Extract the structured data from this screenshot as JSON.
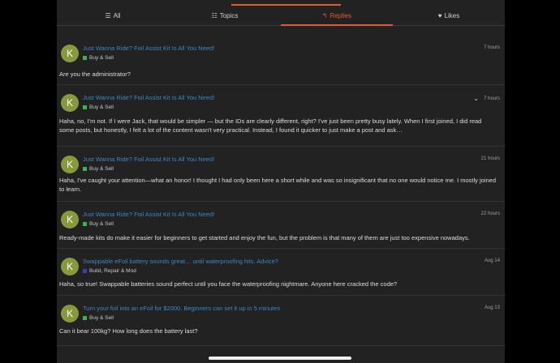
{
  "colors": {
    "accent": "#e45735",
    "link": "#3e86c4",
    "avatar": "#869a3c"
  },
  "tabs": [
    {
      "label": "All",
      "icon": "list-icon",
      "active": false
    },
    {
      "label": "Topics",
      "icon": "list-bullet-icon",
      "active": false
    },
    {
      "label": "Replies",
      "icon": "reply-icon",
      "active": true
    },
    {
      "label": "Likes",
      "icon": "heart-icon",
      "active": false
    }
  ],
  "posts": [
    {
      "avatar": "K",
      "title": "Just Wanna Ride? Foil Assist Kit Is All You Need!",
      "category": "Buy & Sell",
      "category_color": "#3ab54a",
      "time": "7 hours",
      "body": "Are you the administrator?"
    },
    {
      "avatar": "K",
      "title": "Just Wanna Ride? Foil Assist Kit Is All You Need!",
      "category": "Buy & Sell",
      "category_color": "#3ab54a",
      "time": "7 hours",
      "body": "Haha, no, I'm not. If I were Jack, that would be simpler — but the IDs are clearly different, right? I've just been pretty busy lately. When I first joined, I did read some posts, but honestly, I felt a lot of the content wasn't very practical. Instead, I found it quicker to just make a post and ask…"
    },
    {
      "avatar": "K",
      "title": "Just Wanna Ride? Foil Assist Kit Is All You Need!",
      "category": "Buy & Sell",
      "category_color": "#3ab54a",
      "time": "21 hours",
      "body": "Haha, I've caught your attention—what an honor! I thought I had only been here a short while and was so insignificant that no one would notice me. I mostly joined to learn."
    },
    {
      "avatar": "K",
      "title": "Just Wanna Ride? Foil Assist Kit Is All You Need!",
      "category": "Buy & Sell",
      "category_color": "#3ab54a",
      "time": "22 hours",
      "body": "Ready-made kits do make it easier for beginners to get started and enjoy the fun, but the problem is that many of them are just too expensive nowadays."
    },
    {
      "avatar": "K",
      "title": "Swappable eFoil battery sounds great… until waterproofing hits. Advice?",
      "category": "Build, Repair & Mod",
      "category_color": "#3b3fb5",
      "time": "Aug 14",
      "body": "Haha, so true! Swappable batteries sound perfect until you face the waterproofing nightmare. Anyone here cracked the code?"
    },
    {
      "avatar": "K",
      "title": "Turn your foil into an eFoil for $2000. Beginners can set it up in 5 minutes",
      "category": "Buy & Sell",
      "category_color": "#3ab54a",
      "time": "Aug 13",
      "body": "Can it bear 100kg? How long does the battery last?"
    }
  ]
}
